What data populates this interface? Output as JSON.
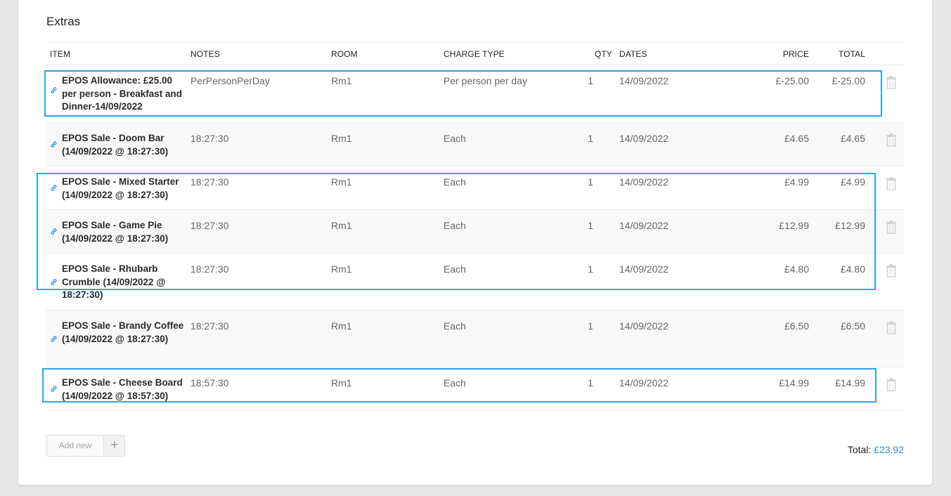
{
  "section_title": "Extras",
  "columns": {
    "item": "ITEM",
    "notes": "NOTES",
    "room": "ROOM",
    "charge_type": "CHARGE TYPE",
    "qty": "QTY",
    "dates": "DATES",
    "price": "PRICE",
    "total": "TOTAL"
  },
  "rows": [
    {
      "item": "EPOS Allowance: £25.00 per person - Breakfast and Dinner-14/09/2022",
      "notes": "PerPersonPerDay",
      "room": "Rm1",
      "charge_type": "Per person per day",
      "qty": "1",
      "dates": "14/09/2022",
      "price": "£-25.00",
      "total": "£-25.00",
      "highlighted": true
    },
    {
      "item": "EPOS Sale - Doom Bar (14/09/2022 @ 18:27:30)",
      "notes": "18:27:30",
      "room": "Rm1",
      "charge_type": "Each",
      "qty": "1",
      "dates": "14/09/2022",
      "price": "£4.65",
      "total": "£4.65",
      "highlighted": false
    },
    {
      "item": "EPOS Sale - Mixed Starter (14/09/2022 @ 18:27:30)",
      "notes": "18:27:30",
      "room": "Rm1",
      "charge_type": "Each",
      "qty": "1",
      "dates": "14/09/2022",
      "price": "£4.99",
      "total": "£4.99",
      "highlighted": true
    },
    {
      "item": "EPOS Sale - Game Pie (14/09/2022 @ 18:27:30)",
      "notes": "18:27:30",
      "room": "Rm1",
      "charge_type": "Each",
      "qty": "1",
      "dates": "14/09/2022",
      "price": "£12.99",
      "total": "£12.99",
      "highlighted": true
    },
    {
      "item": "EPOS Sale - Rhubarb Crumble (14/09/2022 @ 18:27:30)",
      "notes": "18:27:30",
      "room": "Rm1",
      "charge_type": "Each",
      "qty": "1",
      "dates": "14/09/2022",
      "price": "£4.80",
      "total": "£4.80",
      "highlighted": true
    },
    {
      "item": "EPOS Sale - Brandy Coffee (14/09/2022 @ 18:27:30)",
      "notes": "18:27:30",
      "room": "Rm1",
      "charge_type": "Each",
      "qty": "1",
      "dates": "14/09/2022",
      "price": "£6.50",
      "total": "£6.50",
      "highlighted": false
    },
    {
      "item": "EPOS Sale - Cheese Board (14/09/2022 @ 18:57:30)",
      "notes": "18:57:30",
      "room": "Rm1",
      "charge_type": "Each",
      "qty": "1",
      "dates": "14/09/2022",
      "price": "£14.99",
      "total": "£14.99",
      "highlighted": true
    }
  ],
  "icons": {
    "row_link": "link-icon",
    "row_delete": "trash-icon",
    "add": "plus-icon"
  },
  "add_button": {
    "label": "Add new",
    "icon": "+"
  },
  "summary": {
    "total_label": "Total:",
    "total_value": "£23.92"
  },
  "colors": {
    "accent": "#1d8fe1",
    "highlight_border": "#29a8e0",
    "row_alt": "#f8f8f8"
  }
}
